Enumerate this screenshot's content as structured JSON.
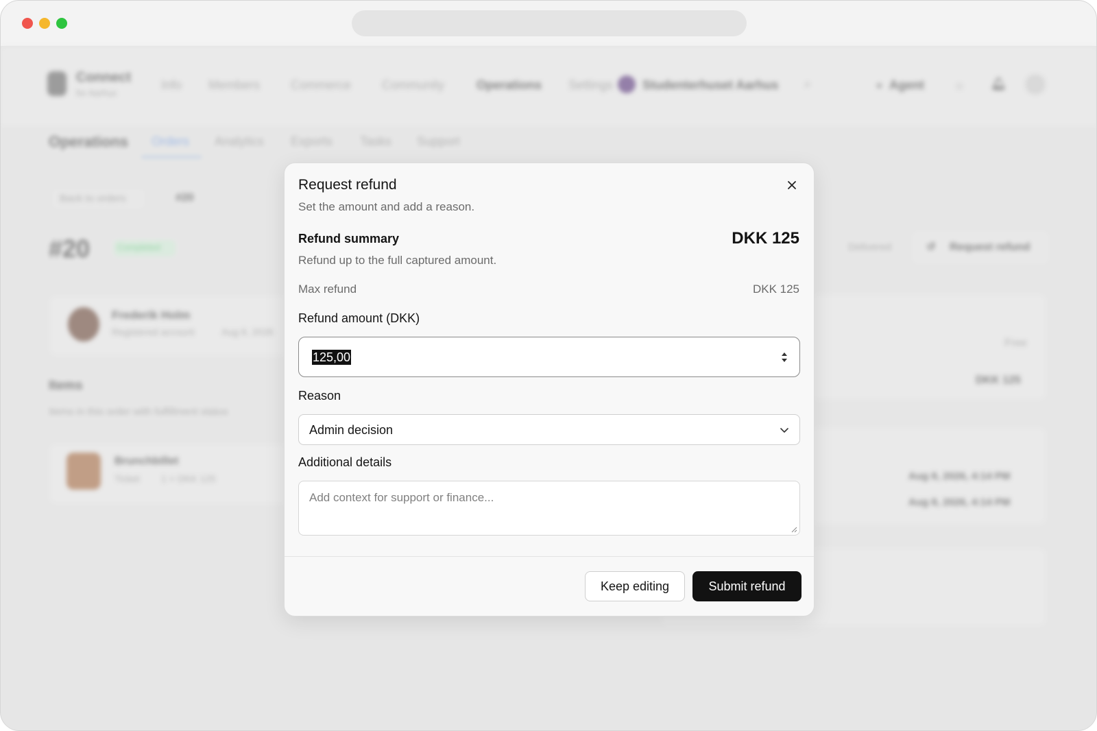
{
  "background": {
    "brand_name": "Connect",
    "brand_sub": "for Aarhus",
    "nav_items": [
      "Info",
      "Members",
      "Commerce",
      "Community",
      "Operations",
      "Settings"
    ],
    "org_name": "Studenterhuset Aarhus",
    "agent_label": "Agent",
    "section_title": "Operations",
    "tabs": [
      "Orders",
      "Analytics",
      "Exports",
      "Tasks",
      "Support"
    ],
    "back_label": "Back to orders",
    "breadcrumb_current": "#20",
    "order_number": "#20",
    "order_status": "Completed",
    "customer_name": "Frederik Holm",
    "customer_meta": "Registered account",
    "customer_date": "Aug 8, 2026",
    "items_title": "Items",
    "items_sub": "Items in this order with fulfillment status",
    "item_name": "Brunchbillet",
    "item_meta": "Ticket",
    "item_price": "1 × DKK 125",
    "action_delivered": "Delivered",
    "action_refund": "Request refund",
    "shipping_value": "Free",
    "total_value": "DKK 125",
    "created_at": "Aug 8, 2026, 4:14 PM",
    "updated_at": "Aug 8, 2026, 4:14 PM"
  },
  "modal": {
    "title": "Request refund",
    "subtitle": "Set the amount and add a reason.",
    "summary_title": "Refund summary",
    "summary_amount": "DKK 125",
    "summary_sub": "Refund up to the full captured amount.",
    "max_label": "Max refund",
    "max_value": "DKK 125",
    "amount_label": "Refund amount (DKK)",
    "amount_value": "125,00",
    "reason_label": "Reason",
    "reason_value": "Admin decision",
    "details_label": "Additional details",
    "details_placeholder": "Add context for support or finance...",
    "keep_label": "Keep editing",
    "submit_label": "Submit refund"
  }
}
